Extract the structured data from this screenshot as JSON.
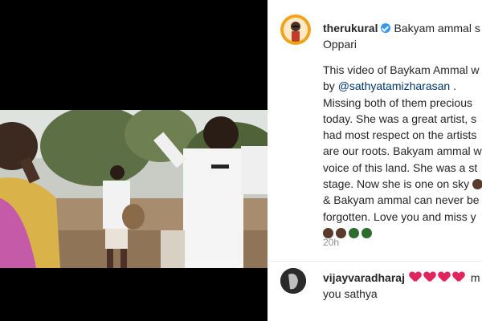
{
  "post": {
    "username": "therukural",
    "headline_start": "Bakyam ammal s",
    "headline_cont": "Oppari",
    "caption_lines": [
      "This video of Baykam Ammal w",
      "by",
      "Missing both of them precious",
      "today. She was a great artist, s",
      "had most respect on the artists",
      "are our roots. Bakyam ammal w",
      "voice of this land. She was a st",
      "stage. Now she is one on sky",
      "& Bakyam ammal can never be",
      "forgotten. Love you and miss y"
    ],
    "mention": "@sathyatamizharasan",
    "mention_suffix": " .",
    "time": "20h"
  },
  "comment": {
    "username": "vijayvaradharaj",
    "text_tail": "m",
    "text_line2": "you sathya"
  },
  "icons": {
    "verified": "verified-badge-icon",
    "heart": "red-heart-icon"
  },
  "colors": {
    "verified": "#3897f0",
    "link": "#00376b",
    "heart": "#e0245e"
  }
}
